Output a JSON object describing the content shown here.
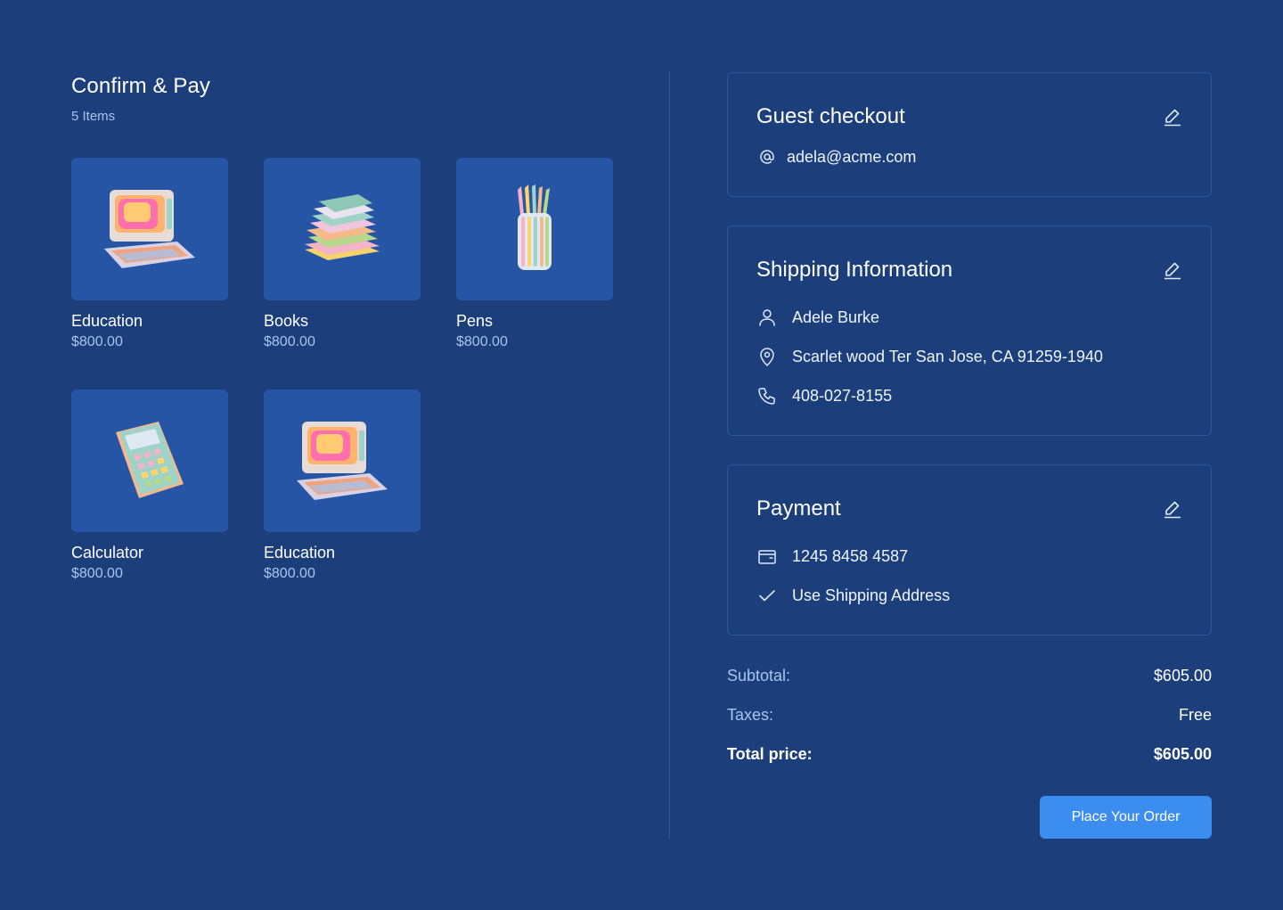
{
  "header": {
    "title": "Confirm & Pay",
    "items_count": "5 Items"
  },
  "products": [
    {
      "name": "Education",
      "price": "$800.00",
      "image": "retro-computer"
    },
    {
      "name": "Books",
      "price": "$800.00",
      "image": "book-stack"
    },
    {
      "name": "Pens",
      "price": "$800.00",
      "image": "pencil-cup"
    },
    {
      "name": "Calculator",
      "price": "$800.00",
      "image": "calculator"
    },
    {
      "name": "Education",
      "price": "$800.00",
      "image": "retro-computer"
    }
  ],
  "guest": {
    "title": "Guest checkout",
    "email": "adela@acme.com",
    "icon": "at-icon"
  },
  "shipping": {
    "title": "Shipping Information",
    "name": "Adele Burke",
    "address": "Scarlet wood Ter San Jose, CA 91259-1940",
    "phone": "408-027-8155"
  },
  "payment": {
    "title": "Payment",
    "card_number": "1245 8458 4587",
    "billing_option": "Use Shipping Address"
  },
  "summary": {
    "subtotal_label": "Subtotal:",
    "subtotal_value": "$605.00",
    "taxes_label": "Taxes:",
    "taxes_value": "Free",
    "total_label": "Total price:",
    "total_value": "$605.00"
  },
  "actions": {
    "place_order": "Place Your Order"
  },
  "colors": {
    "background": "#1c3e7b",
    "card_border": "#2d5799",
    "thumb_bg": "#2555a4",
    "accent": "#3b8ef0",
    "muted_text": "#a9c4ee"
  }
}
